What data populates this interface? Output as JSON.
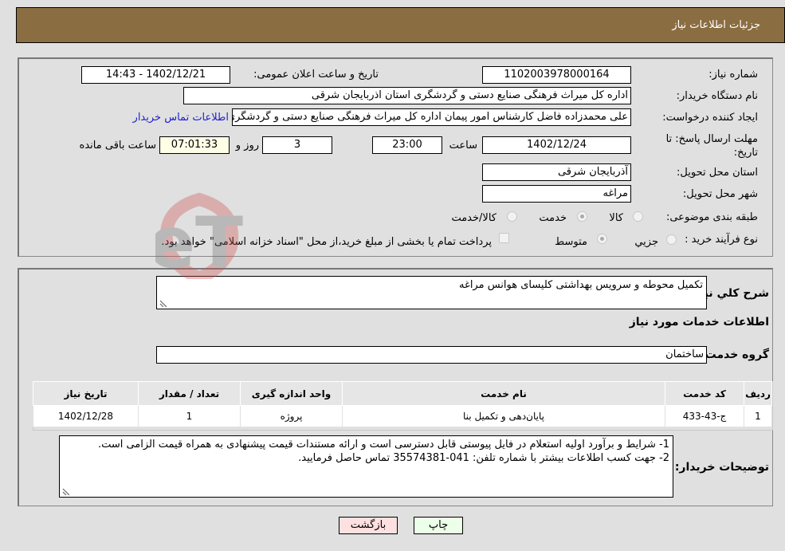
{
  "header": {
    "title": "جزئیات اطلاعات نیاز"
  },
  "details": {
    "need_number": {
      "label": "شماره نیاز:",
      "value": "1102003978000164"
    },
    "announce_datetime": {
      "label": "تاریخ و ساعت اعلان عمومی:",
      "value": "1402/12/21 - 14:43"
    },
    "buyer_org": {
      "label": "نام دستگاه خریدار:",
      "value": "اداره کل میراث فرهنگی  صنایع دستی و گردشگری استان اذربایجان شرقی"
    },
    "requester": {
      "label": "ایجاد کننده درخواست:",
      "value": "علی محمدزاده فاضل کارشناس امور پیمان اداره کل میراث فرهنگی  صنایع دستی و گردشگری استان اذربایجان شرقی"
    },
    "buyer_contact_link": "اطلاعات تماس خریدار",
    "deadline": {
      "label": "مهلت ارسال پاسخ: تا تاریخ:",
      "date": "1402/12/24",
      "time_label": "ساعت",
      "time": "23:00",
      "days": "3",
      "days_label": "روز و",
      "remaining": "07:01:33",
      "remaining_label": "ساعت باقی مانده"
    },
    "delivery_province": {
      "label": "استان محل تحویل:",
      "value": "آذربایجان شرقی"
    },
    "delivery_city": {
      "label": "شهر محل تحویل:",
      "value": "مراغه"
    },
    "category": {
      "label": "طبقه بندی موضوعی:",
      "options": [
        "کالا",
        "خدمت",
        "کالا/خدمت"
      ],
      "selected": "خدمت"
    },
    "purchase_type": {
      "label": "نوع فرآیند خرید :",
      "options": [
        "جزیي",
        "متوسط"
      ],
      "selected": "متوسط",
      "treasury_note": "پرداخت تمام یا بخشی از مبلغ خرید،از محل \"اسناد خزانه اسلامی\" خواهد بود.",
      "treasury_checked": false
    }
  },
  "general": {
    "description_label": "شرح کلي نیاز:",
    "description": "تکمیل محوطه و سرویس بهداشتی کلیسای هوانس مراغه",
    "services_title": "اطلاعات خدمات مورد نیاز",
    "service_group_label": "گروه خدمت:",
    "service_group": "ساختمان"
  },
  "table": {
    "headers": [
      "ردیف",
      "کد خدمت",
      "نام خدمت",
      "واحد اندازه گیری",
      "تعداد / مقدار",
      "تاریخ نیاز"
    ],
    "rows": [
      [
        "1",
        "ج-43-433",
        "پایان‌دهی و تکمیل بنا",
        "پروژه",
        "1",
        "1402/12/28"
      ]
    ]
  },
  "buyer_notes": {
    "label": "توضیحات خریدار:",
    "lines": [
      "1- شرایط و برآورد اولیه استعلام در فایل پیوستی قابل دسترسی است و ارائه مستندات قیمت پیشنهادی به همراه قیمت الزامی است.",
      "2- جهت کسب اطلاعات بیشتر  با شماره تلفن: 041-35574381  تماس حاصل فرمایید."
    ]
  },
  "buttons": {
    "print": "چاپ",
    "back": "بازگشت"
  },
  "watermark": "AriaTender.neT"
}
